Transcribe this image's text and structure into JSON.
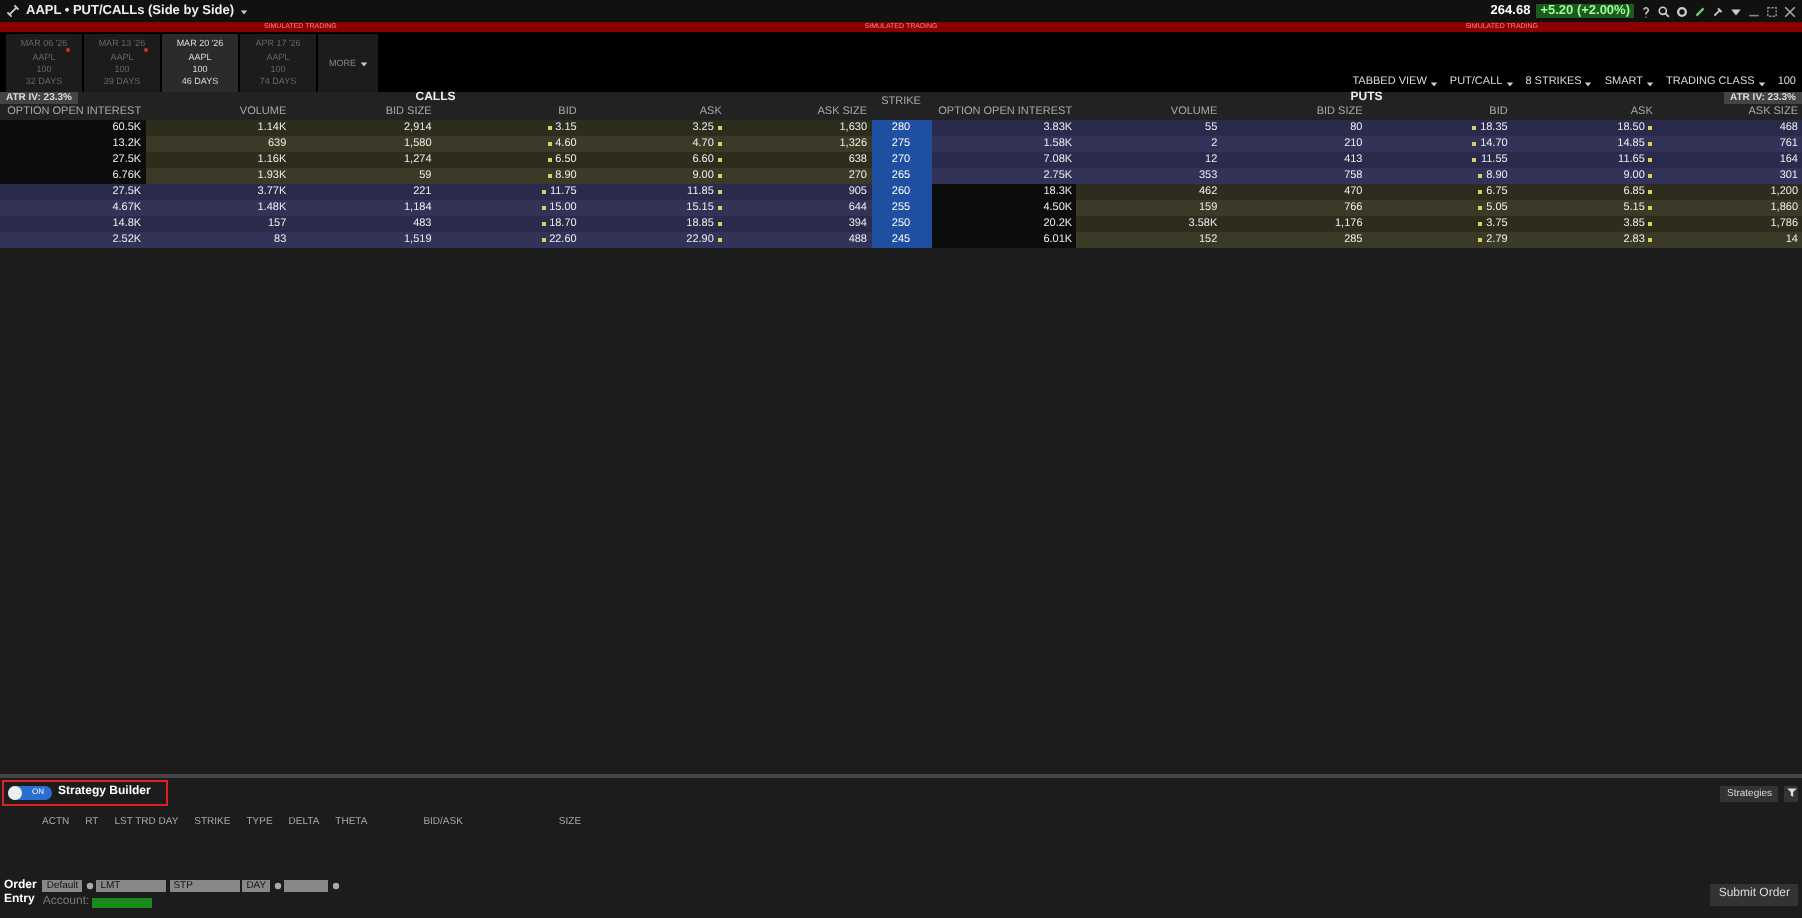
{
  "window": {
    "title": "AAPL • PUT/CALLs (Side by Side)",
    "last_price": "264.68",
    "change": "+5.20 (+2.00%)"
  },
  "banners": [
    "SIMULATED TRADING",
    "SIMULATED TRADING",
    "SIMULATED TRADING"
  ],
  "expiry_tabs": [
    {
      "date": "MAR 06 '26",
      "symbol": "AAPL",
      "multiplier": "100",
      "days": "32 DAYS",
      "selected": false,
      "flagged": true
    },
    {
      "date": "MAR 13 '26",
      "symbol": "AAPL",
      "multiplier": "100",
      "days": "39 DAYS",
      "selected": false,
      "flagged": true
    },
    {
      "date": "MAR 20 '26",
      "symbol": "AAPL",
      "multiplier": "100",
      "days": "46 DAYS",
      "selected": true,
      "flagged": false
    },
    {
      "date": "APR 17 '26",
      "symbol": "AAPL",
      "multiplier": "100",
      "days": "74 DAYS",
      "selected": false,
      "flagged": false
    }
  ],
  "more_button": "MORE",
  "toolbar": {
    "dropdowns": [
      "TABBED VIEW",
      "PUT/CALL",
      "8 STRIKES",
      "SMART",
      "TRADING CLASS"
    ],
    "trading_class": "100"
  },
  "atr_iv_left": "ATR IV: 23.3%",
  "atr_iv_right": "ATR IV: 23.3%",
  "calls_title": "CALLS",
  "puts_title": "PUTS",
  "strike_header": "STRIKE",
  "call_columns": [
    "OPTION OPEN INTEREST",
    "VOLUME",
    "BID SIZE",
    "BID",
    "ASK",
    "ASK SIZE"
  ],
  "put_columns": [
    "OPTION OPEN INTEREST",
    "VOLUME",
    "BID SIZE",
    "BID",
    "ASK",
    "ASK SIZE"
  ],
  "rows": [
    {
      "strike": "280",
      "call": {
        "itm": false,
        "cells": [
          "60.5K",
          "1.14K",
          "2,914",
          "3.15",
          "3.25",
          "1,630"
        ]
      },
      "put": {
        "itm": true,
        "cells": [
          "3.83K",
          "55",
          "80",
          "18.35",
          "18.50",
          "468"
        ]
      }
    },
    {
      "strike": "275",
      "call": {
        "itm": false,
        "cells": [
          "13.2K",
          "639",
          "1,580",
          "4.60",
          "4.70",
          "1,326"
        ]
      },
      "put": {
        "itm": true,
        "cells": [
          "1.58K",
          "2",
          "210",
          "14.70",
          "14.85",
          "761"
        ]
      }
    },
    {
      "strike": "270",
      "call": {
        "itm": false,
        "cells": [
          "27.5K",
          "1.16K",
          "1,274",
          "6.50",
          "6.60",
          "638"
        ]
      },
      "put": {
        "itm": true,
        "cells": [
          "7.08K",
          "12",
          "413",
          "11.55",
          "11.65",
          "164"
        ]
      }
    },
    {
      "strike": "265",
      "call": {
        "itm": false,
        "cells": [
          "6.76K",
          "1.93K",
          "59",
          "8.90",
          "9.00",
          "270"
        ]
      },
      "put": {
        "itm": true,
        "cells": [
          "2.75K",
          "353",
          "758",
          "8.90",
          "9.00",
          "301"
        ]
      }
    },
    {
      "strike": "260",
      "call": {
        "itm": true,
        "cells": [
          "27.5K",
          "3.77K",
          "221",
          "11.75",
          "11.85",
          "905"
        ]
      },
      "put": {
        "itm": false,
        "cells": [
          "18.3K",
          "462",
          "470",
          "6.75",
          "6.85",
          "1,200"
        ]
      }
    },
    {
      "strike": "255",
      "call": {
        "itm": true,
        "cells": [
          "4.67K",
          "1.48K",
          "1,184",
          "15.00",
          "15.15",
          "644"
        ]
      },
      "put": {
        "itm": false,
        "cells": [
          "4.50K",
          "159",
          "766",
          "5.05",
          "5.15",
          "1,860"
        ]
      }
    },
    {
      "strike": "250",
      "call": {
        "itm": true,
        "cells": [
          "14.8K",
          "157",
          "483",
          "18.70",
          "18.85",
          "394"
        ]
      },
      "put": {
        "itm": false,
        "cells": [
          "20.2K",
          "3.58K",
          "1,176",
          "3.75",
          "3.85",
          "1,786"
        ]
      }
    },
    {
      "strike": "245",
      "call": {
        "itm": true,
        "cells": [
          "2.52K",
          "83",
          "1,519",
          "22.60",
          "22.90",
          "488"
        ]
      },
      "put": {
        "itm": false,
        "cells": [
          "6.01K",
          "152",
          "285",
          "2.79",
          "2.83",
          "14"
        ]
      }
    }
  ],
  "strategy_builder": {
    "toggle": {
      "label": "ON",
      "on": true
    },
    "title": "Strategy Builder",
    "columns": [
      "ACTN",
      "RT",
      "LST TRD DAY",
      "STRIKE",
      "TYPE",
      "DELTA",
      "THETA",
      "BID/ASK",
      "SIZE"
    ],
    "strategies_button": "Strategies"
  },
  "order_entry": {
    "label_lines": [
      "Order",
      "Entry"
    ],
    "preset": "Default",
    "order_type": "LMT",
    "stop_type": "STP",
    "tif": "DAY",
    "account_label": "Account:",
    "submit": "Submit Order"
  }
}
